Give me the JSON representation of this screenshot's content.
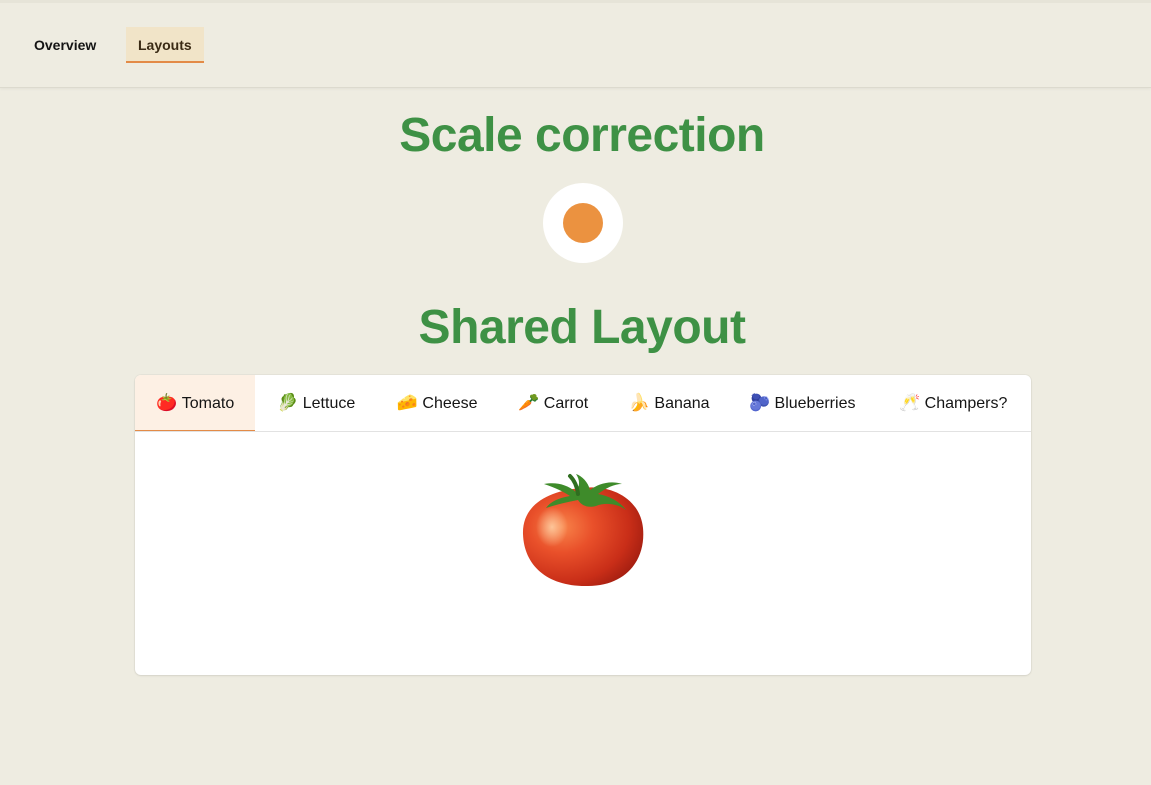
{
  "nav": {
    "tabs": [
      {
        "label": "Overview",
        "active": false
      },
      {
        "label": "Layouts",
        "active": true
      }
    ]
  },
  "sections": {
    "scale_title": "Scale correction",
    "shared_title": "Shared Layout"
  },
  "colors": {
    "background": "#EEECE1",
    "heading_green": "#3E9145",
    "accent_orange": "#E38B47",
    "dot_orange": "#EB9240",
    "active_tab_bg": "#FDF0E4"
  },
  "shared_layout": {
    "tabs": [
      {
        "emoji": "🍅",
        "label": "Tomato",
        "active": true
      },
      {
        "emoji": "🥬",
        "label": "Lettuce",
        "active": false
      },
      {
        "emoji": "🧀",
        "label": "Cheese",
        "active": false
      },
      {
        "emoji": "🥕",
        "label": "Carrot",
        "active": false
      },
      {
        "emoji": "🍌",
        "label": "Banana",
        "active": false
      },
      {
        "emoji": "🫐",
        "label": "Blueberries",
        "active": false
      },
      {
        "emoji": "🥂",
        "label": "Champers?",
        "active": false
      }
    ],
    "selected_emoji_icon": "tomato-icon"
  }
}
